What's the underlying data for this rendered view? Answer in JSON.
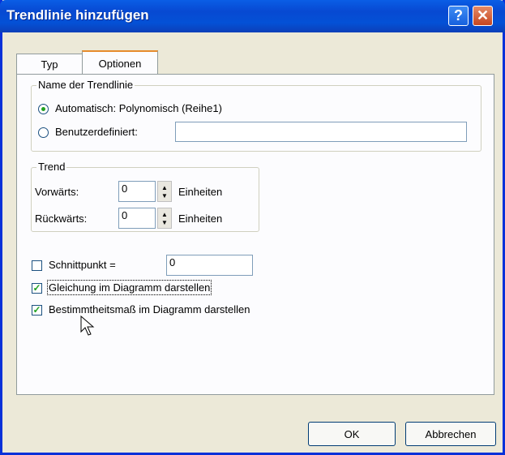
{
  "window": {
    "title": "Trendlinie hinzufügen"
  },
  "tabs": [
    {
      "label": "Typ"
    },
    {
      "label": "Optionen"
    }
  ],
  "name_group": {
    "legend": "Name der Trendlinie",
    "automatic_label": "Automatisch: Polynomisch (Reihe1)",
    "custom_label": "Benutzerdefiniert:",
    "custom_value": ""
  },
  "trend_group": {
    "legend": "Trend",
    "forward_label": "Vorwärts:",
    "forward_value": "0",
    "backward_label": "Rückwärts:",
    "backward_value": "0",
    "unit": "Einheiten"
  },
  "intercept": {
    "label": "Schnittpunkt =",
    "value": "0"
  },
  "show_equation": {
    "label": "Gleichung im Diagramm darstellen"
  },
  "show_r2": {
    "label": "Bestimmtheitsmaß im Diagramm darstellen"
  },
  "buttons": {
    "ok": "OK",
    "cancel": "Abbrechen"
  },
  "icons": {
    "help": "help-icon",
    "close": "close-icon",
    "cursor": "mouse-cursor-icon"
  }
}
